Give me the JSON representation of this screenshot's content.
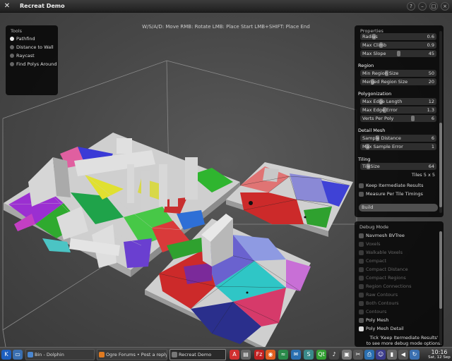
{
  "window": {
    "title": "Recreat Demo",
    "buttons": [
      "?",
      "–",
      "□",
      "×"
    ]
  },
  "hint": "W/S/A/D: Move  RMB: Rotate   LMB: Place Start   LMB+SHIFT: Place End",
  "tools": {
    "title": "Tools",
    "items": [
      {
        "label": "Pathfind",
        "selected": true
      },
      {
        "label": "Distance to Wall",
        "selected": false
      },
      {
        "label": "Raycast",
        "selected": false
      },
      {
        "label": "Find Polys Around",
        "selected": false
      }
    ]
  },
  "properties": {
    "title": "Properties",
    "top_sliders": [
      {
        "label": "Radius",
        "value": "0.6",
        "fraction": 0.15
      },
      {
        "label": "Max Climb",
        "value": "0.9",
        "fraction": 0.25
      },
      {
        "label": "Max Slope",
        "value": "45",
        "fraction": 0.5
      }
    ],
    "region": {
      "title": "Region",
      "sliders": [
        {
          "label": "Min Region Size",
          "value": "50",
          "fraction": 0.33
        },
        {
          "label": "Merged Region Size",
          "value": "20",
          "fraction": 0.13
        }
      ]
    },
    "polygonization": {
      "title": "Polygonization",
      "sliders": [
        {
          "label": "Max Edge Length",
          "value": "12",
          "fraction": 0.25
        },
        {
          "label": "Max Edge Error",
          "value": "1.3",
          "fraction": 0.3
        },
        {
          "label": "Verts Per Poly",
          "value": "6",
          "fraction": 0.7
        }
      ]
    },
    "detail_mesh": {
      "title": "Detail Mesh",
      "sliders": [
        {
          "label": "Sample Distance",
          "value": "6",
          "fraction": 0.2
        },
        {
          "label": "Max Sample Error",
          "value": "1",
          "fraction": 0.06
        }
      ]
    },
    "tiling": {
      "title": "Tiling",
      "sliders": [
        {
          "label": "TileSize",
          "value": "64",
          "fraction": 0.07
        }
      ],
      "tiles": "Tiles  5 x 5"
    },
    "checks": [
      {
        "label": "Keep Itermediate Results",
        "checked": false
      },
      {
        "label": "Measure Per Tile Timings",
        "checked": false
      }
    ],
    "build": "Build"
  },
  "debug": {
    "title": "Debug Mode",
    "items": [
      {
        "label": "Navmesh BVTree",
        "enabled": true,
        "checked": false
      },
      {
        "label": "Voxels",
        "enabled": false,
        "checked": false
      },
      {
        "label": "Walkable Voxels",
        "enabled": false,
        "checked": false
      },
      {
        "label": "Compact",
        "enabled": false,
        "checked": false
      },
      {
        "label": "Compact Distance",
        "enabled": false,
        "checked": false
      },
      {
        "label": "Compact Regions",
        "enabled": false,
        "checked": false
      },
      {
        "label": "Region Connections",
        "enabled": false,
        "checked": false
      },
      {
        "label": "Raw Contours",
        "enabled": false,
        "checked": false
      },
      {
        "label": "Both Contours",
        "enabled": false,
        "checked": false
      },
      {
        "label": "Contours",
        "enabled": false,
        "checked": false
      },
      {
        "label": "Poly Mesh",
        "enabled": true,
        "checked": false
      },
      {
        "label": "Poly Mesh Detail",
        "enabled": true,
        "checked": true
      }
    ],
    "note_line1": "Tick 'Keep Itermediate Results'",
    "note_line2": "to see more debug mode options."
  },
  "taskbar": {
    "tasks": [
      {
        "label": "Bin - Dolphin",
        "active": false
      },
      {
        "label": "Ogre Forums • Post a reply - M",
        "active": false
      },
      {
        "label": "Recreat Demo",
        "active": true
      }
    ],
    "clock": "10:16",
    "date": "Sat, 12 Sep"
  },
  "colors": {
    "accent_red": "#cc2b2b",
    "accent_blue": "#3340c8",
    "accent_cyan": "#27c6c6",
    "accent_green": "#3fbf3f",
    "accent_purple": "#a53fcf"
  }
}
